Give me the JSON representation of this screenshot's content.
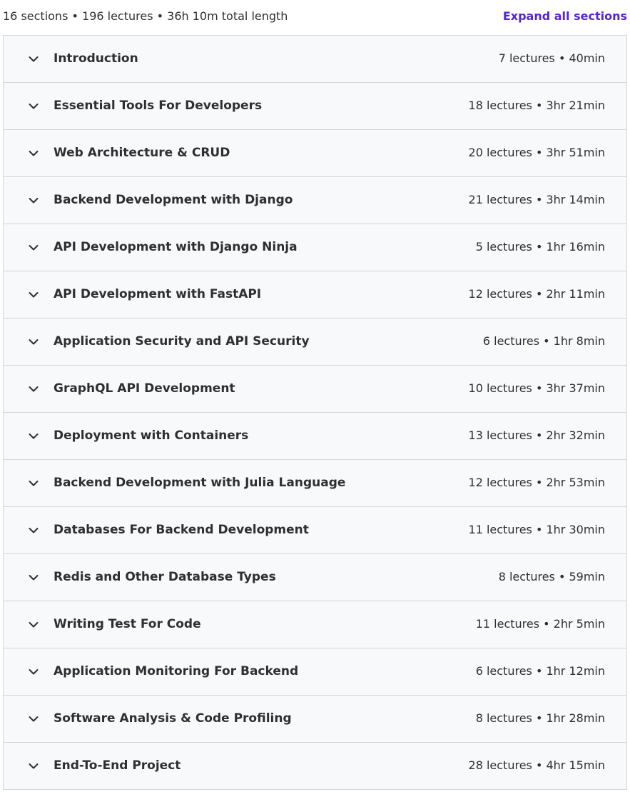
{
  "summary": {
    "text": "16 sections • 196 lectures • 36h 10m total length",
    "expand_label": "Expand all sections"
  },
  "colors": {
    "link": "#5624d0",
    "row_background": "#f7f9fa",
    "border": "#d1d7dc",
    "text": "#2d2f31"
  },
  "chevron_icon": "chevron-down-icon",
  "sections": [
    {
      "title": "Introduction",
      "meta": "7 lectures • 40min"
    },
    {
      "title": "Essential Tools For Developers",
      "meta": "18 lectures • 3hr 21min"
    },
    {
      "title": "Web Architecture & CRUD",
      "meta": "20 lectures • 3hr 51min"
    },
    {
      "title": "Backend Development with Django",
      "meta": "21 lectures • 3hr 14min"
    },
    {
      "title": "API Development with Django Ninja",
      "meta": "5 lectures • 1hr 16min"
    },
    {
      "title": "API Development with FastAPI",
      "meta": "12 lectures • 2hr 11min"
    },
    {
      "title": "Application Security and API Security",
      "meta": "6 lectures • 1hr 8min"
    },
    {
      "title": "GraphQL API Development",
      "meta": "10 lectures • 3hr 37min"
    },
    {
      "title": "Deployment with Containers",
      "meta": "13 lectures • 2hr 32min"
    },
    {
      "title": "Backend Development with Julia Language",
      "meta": "12 lectures • 2hr 53min"
    },
    {
      "title": "Databases For Backend Development",
      "meta": "11 lectures • 1hr 30min"
    },
    {
      "title": "Redis and Other Database Types",
      "meta": "8 lectures • 59min"
    },
    {
      "title": "Writing Test For Code",
      "meta": "11 lectures • 2hr 5min"
    },
    {
      "title": "Application Monitoring For Backend",
      "meta": "6 lectures • 1hr 12min"
    },
    {
      "title": "Software Analysis & Code Profiling",
      "meta": "8 lectures • 1hr 28min"
    },
    {
      "title": "End-To-End Project",
      "meta": "28 lectures • 4hr 15min"
    }
  ]
}
